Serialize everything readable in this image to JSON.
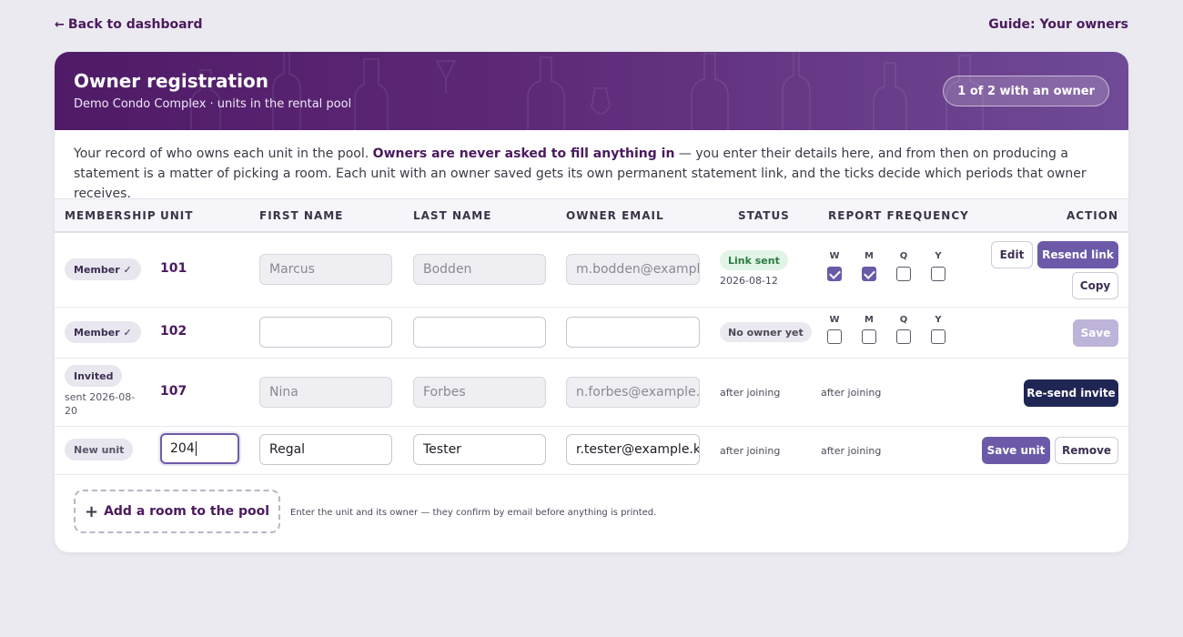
{
  "nav": {
    "back_label": "Back to dashboard",
    "guide_label": "Guide: Your owners"
  },
  "banner": {
    "title": "Owner registration",
    "subtitle": "Demo Condo Complex · units in the rental pool",
    "owner_count": "1 of 2 with an owner"
  },
  "intro": {
    "text_before": "Your record of who owns each unit in the pool. ",
    "emphasis": "Owners are never asked to fill anything in",
    "text_after": " — you enter their details here, and from then on producing a statement is a matter of picking a room. Each unit with an owner saved gets its own permanent statement link, and the ticks decide which periods that owner receives."
  },
  "table": {
    "headers": {
      "membership": "Membership",
      "unit": "Unit",
      "first_name": "First name",
      "last_name": "Last name",
      "owner_email": "Owner email",
      "status": "Status",
      "report_frequency": "Report frequency",
      "action": "Action"
    },
    "freq_labels": {
      "w": "W",
      "m": "M",
      "q": "Q",
      "y": "Y"
    },
    "rows": [
      {
        "membership": "Member ✓",
        "unit": "101",
        "first_name": "Marcus",
        "last_name": "Bodden",
        "email": "m.bodden@example.ky",
        "status": "Link sent",
        "status_date": "2026-08-12",
        "freq": {
          "w": true,
          "m": true,
          "q": false,
          "y": false
        },
        "actions": {
          "edit": "Edit",
          "resend": "Resend link",
          "copy": "Copy"
        }
      },
      {
        "membership": "Member ✓",
        "unit": "102",
        "first_name": "",
        "last_name": "",
        "email": "",
        "status": "No owner yet",
        "freq": {
          "w": false,
          "m": false,
          "q": false,
          "y": false
        },
        "actions": {
          "save": "Save"
        }
      },
      {
        "membership": "Invited",
        "membership_note": "sent 2026-08-20",
        "unit": "107",
        "first_name": "Nina",
        "last_name": "Forbes",
        "email": "n.forbes@example.ky",
        "status": "after joining",
        "frequency_text": "after joining",
        "actions": {
          "resend_invite": "Re-send invite"
        }
      },
      {
        "membership": "New unit",
        "unit": "204",
        "first_name": "Regal",
        "last_name": "Tester",
        "email": "r.tester@example.ky",
        "status": "after joining",
        "frequency_text": "after joining",
        "actions": {
          "save_unit": "Save unit",
          "remove": "Remove"
        }
      }
    ]
  },
  "footer": {
    "add_room_label": "Add a room to the pool",
    "hint": "Enter the unit and its owner — they confirm by email before anything is printed."
  },
  "colors": {
    "brand": "#4a1a5e",
    "primary_button": "#6c5aa9",
    "dark_button": "#1f2654",
    "status_green": "#2d7a45"
  }
}
